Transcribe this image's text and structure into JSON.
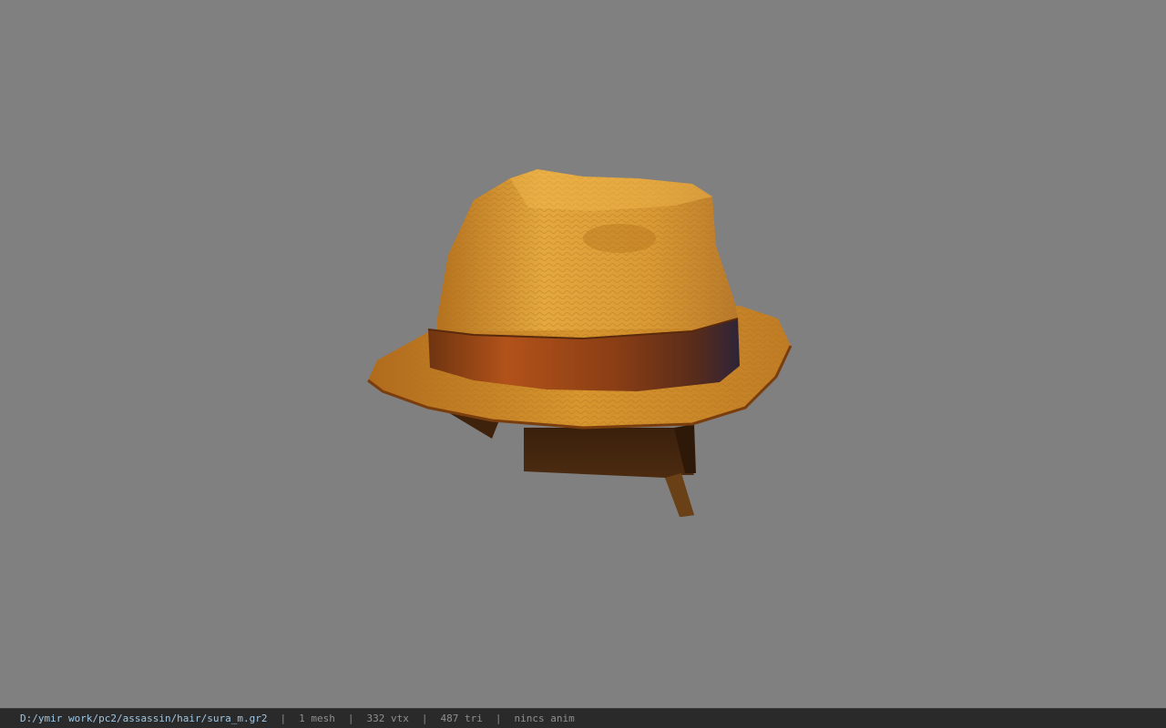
{
  "viewport": {
    "background": "#808080",
    "model_subject": "straw-fedora-hat"
  },
  "statusbar": {
    "file_path": "D:/ymir work/pc2/assassin/hair/sura_m.gr2",
    "separator": "|",
    "mesh_count": "1 mesh",
    "vertex_count": "332 vtx",
    "triangle_count": "487 tri",
    "anim_status": "nincs anim"
  },
  "colors": {
    "straw_light": "#e2a63c",
    "straw_mid": "#c8882a",
    "straw_dark": "#8a5218",
    "band": "#a04a14",
    "band_dark": "#3a2a38",
    "hair_dark": "#4a2a10",
    "path_text": "#9ec7e4"
  }
}
